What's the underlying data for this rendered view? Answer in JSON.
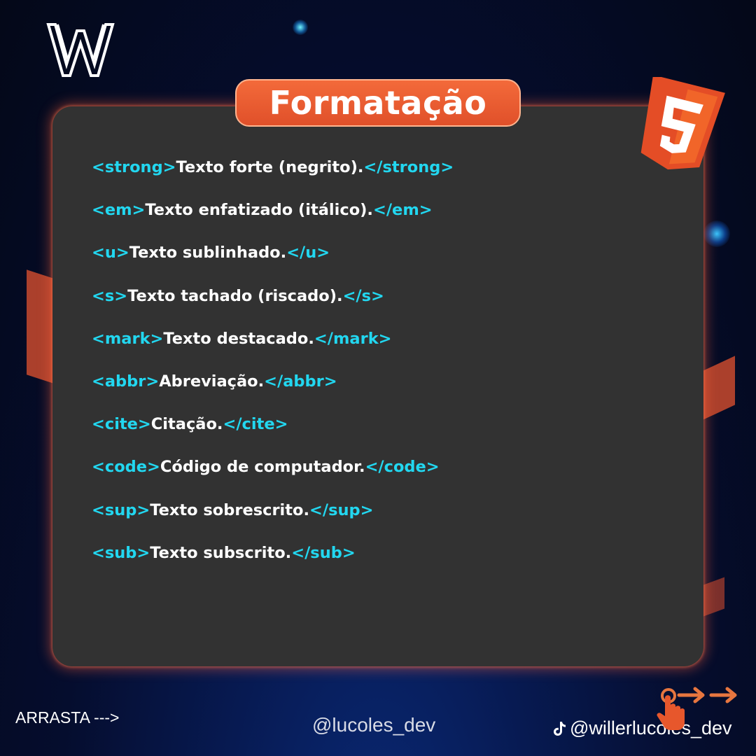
{
  "title": "Formatação",
  "code_lines": [
    {
      "open": "<strong>",
      "text": "Texto forte (negrito).",
      "close": "</strong>"
    },
    {
      "open": "<em>",
      "text": "Texto enfatizado (itálico).",
      "close": "</em>"
    },
    {
      "open": "<u>",
      "text": "Texto sublinhado.",
      "close": "</u>"
    },
    {
      "open": "<s>",
      "text": "Texto tachado (riscado).",
      "close": "</s>"
    },
    {
      "open": "<mark>",
      "text": "Texto destacado.",
      "close": "</mark>"
    },
    {
      "open": "<abbr>",
      "text": "Abreviação.",
      "close": "</abbr>"
    },
    {
      "open": "<cite>",
      "text": "Citação.",
      "close": "</cite>"
    },
    {
      "open": "<code>",
      "text": "Código de computador.",
      "close": "</code>"
    },
    {
      "open": "<sup>",
      "text": "Texto sobrescrito.",
      "close": "</sup>"
    },
    {
      "open": "<sub>",
      "text": "Texto subscrito.",
      "close": "</sub>"
    }
  ],
  "footer": {
    "swipe_hint": "ARRASTA --->",
    "instagram_handle": "@lucoles_dev",
    "tiktok_handle": "@willerlucoles_dev"
  },
  "icons": {
    "logo": "w-logo-icon",
    "badge": "html5-icon",
    "social": "tiktok-icon",
    "swipe": "swipe-hand-icon"
  },
  "colors": {
    "accent_orange": "#e7572c",
    "tag_cyan": "#22d7f0",
    "card_bg": "#323232",
    "text_white": "#ffffff"
  }
}
